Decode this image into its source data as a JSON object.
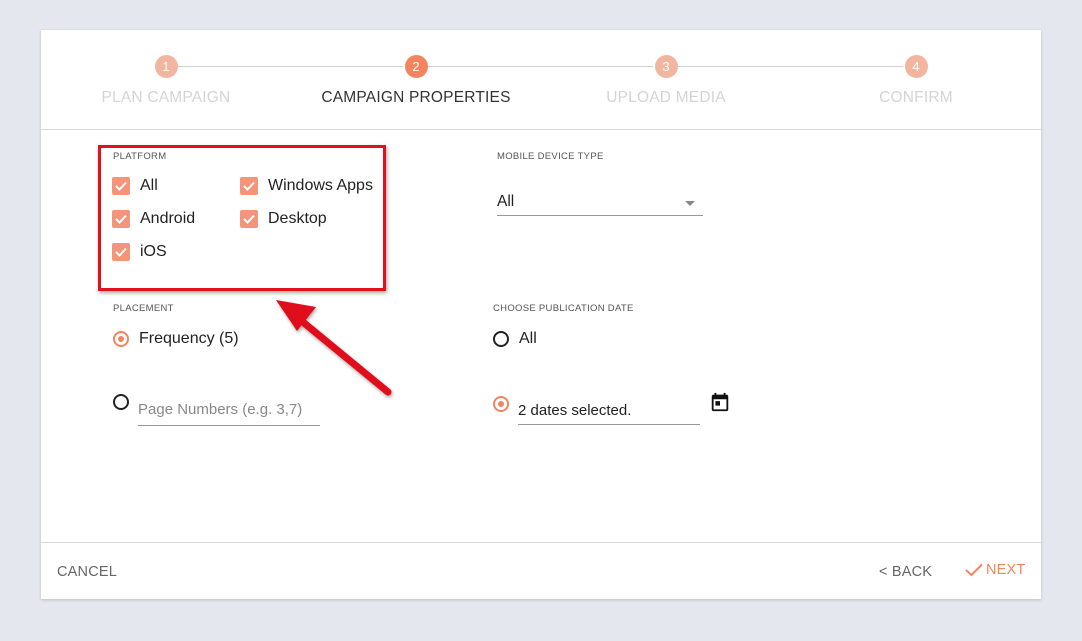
{
  "stepper": {
    "steps": [
      {
        "num": "1",
        "label": "PLAN CAMPAIGN"
      },
      {
        "num": "2",
        "label": "CAMPAIGN PROPERTIES"
      },
      {
        "num": "3",
        "label": "UPLOAD MEDIA"
      },
      {
        "num": "4",
        "label": "CONFIRM"
      }
    ],
    "active_step": 2
  },
  "platform": {
    "label": "PLATFORM",
    "options": [
      {
        "label": "All",
        "checked": true
      },
      {
        "label": "Windows Apps",
        "checked": true
      },
      {
        "label": "Android",
        "checked": true
      },
      {
        "label": "Desktop",
        "checked": true
      },
      {
        "label": "iOS",
        "checked": true
      }
    ]
  },
  "mobile_device_type": {
    "label": "MOBILE DEVICE TYPE",
    "value": "All"
  },
  "placement": {
    "label": "PLACEMENT",
    "frequency_label": "Frequency (5)",
    "page_numbers_placeholder": "Page Numbers (e.g. 3,7)",
    "selected": "frequency"
  },
  "publication_date": {
    "label": "CHOOSE PUBLICATION DATE",
    "all_label": "All",
    "dates_value": "2 dates selected.",
    "selected": "dates"
  },
  "footer": {
    "cancel": "CANCEL",
    "back": "< BACK",
    "next": "NEXT"
  },
  "colors": {
    "accent": "#f4845f",
    "accent_light": "#f2b6a0",
    "annotation": "#e0111b",
    "background": "#e4e7ee"
  }
}
